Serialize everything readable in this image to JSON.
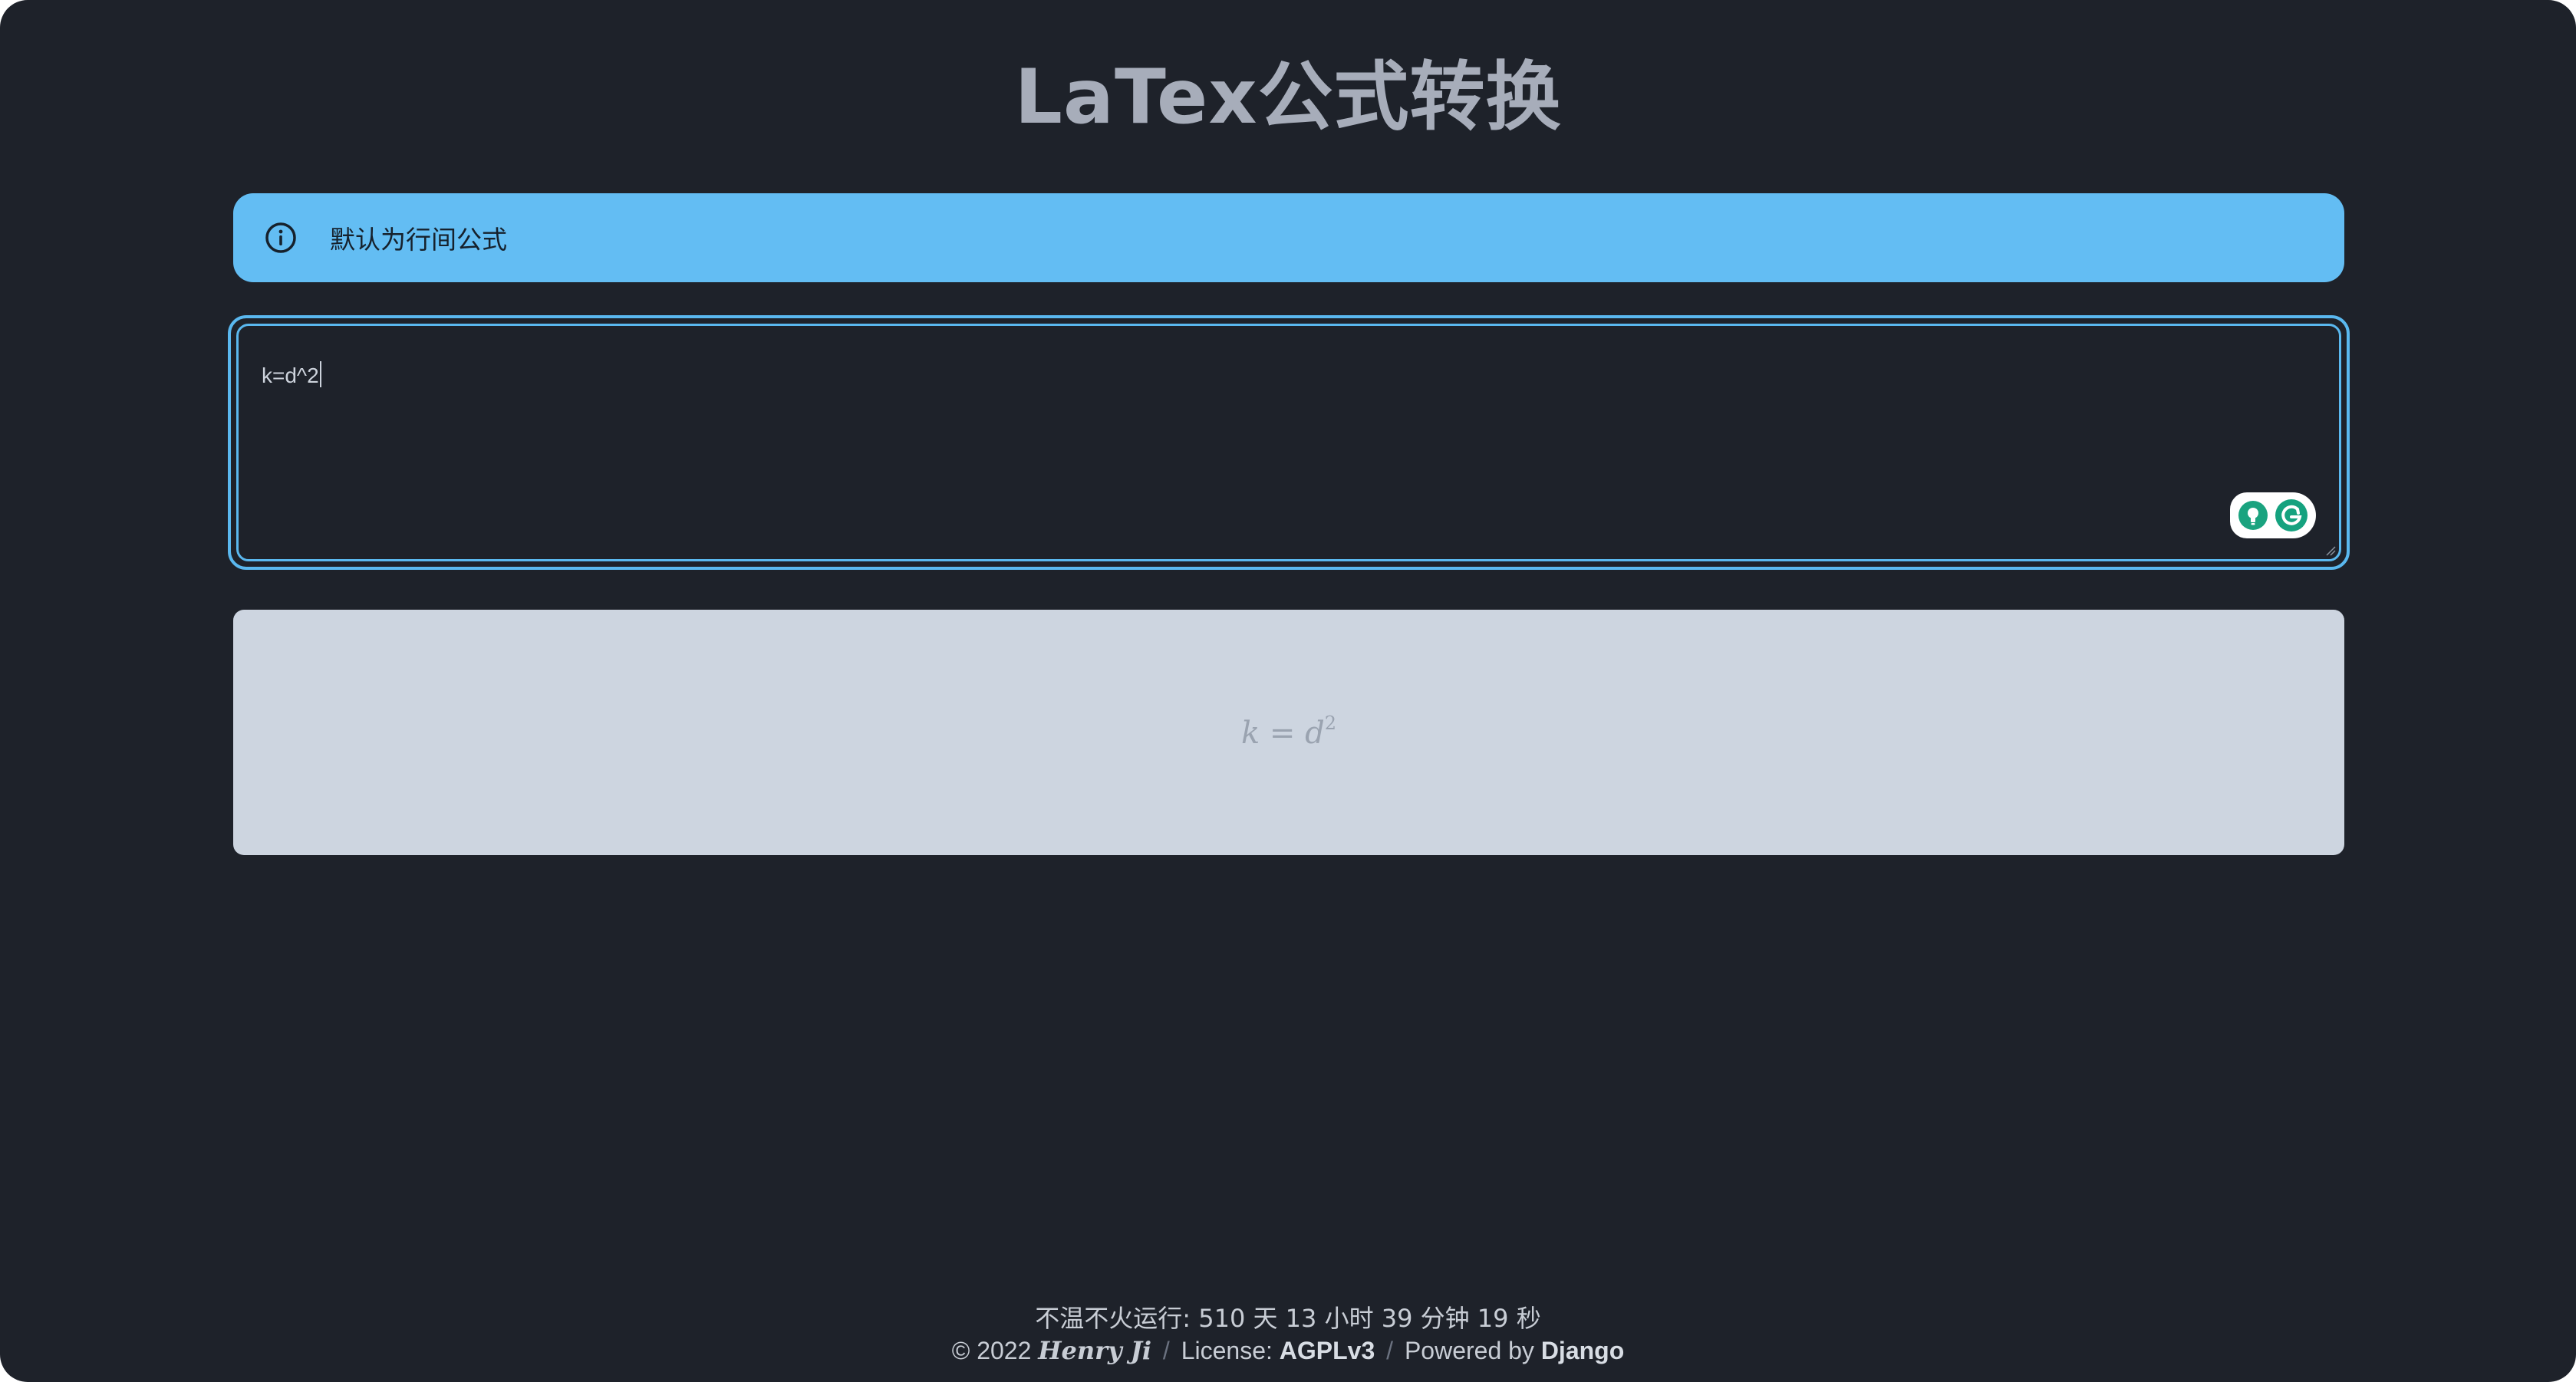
{
  "page": {
    "title": "LaTex公式转换"
  },
  "alert": {
    "icon": "info-icon",
    "text": "默认为行间公式",
    "color": "#63bdf3"
  },
  "editor": {
    "value": "k=d^2",
    "border_color": "#5ab8ef",
    "widget_icons": [
      "lightbulb-icon",
      "grammarly-icon"
    ]
  },
  "preview": {
    "formula_lhs": "k",
    "formula_eq": "=",
    "formula_base": "d",
    "formula_exp": "2"
  },
  "footer": {
    "uptime": "不温不火运行: 510 天 13 小时 39 分钟 19 秒",
    "copyright": "© 2022",
    "author": "Henry Ji",
    "separator": "/",
    "license_label": "License:",
    "license": "AGPLv3",
    "powered_label": "Powered by",
    "powered": "Django"
  },
  "colors": {
    "background": "#1e222a",
    "title": "#a7adba",
    "preview_bg": "#cdd5e0"
  }
}
